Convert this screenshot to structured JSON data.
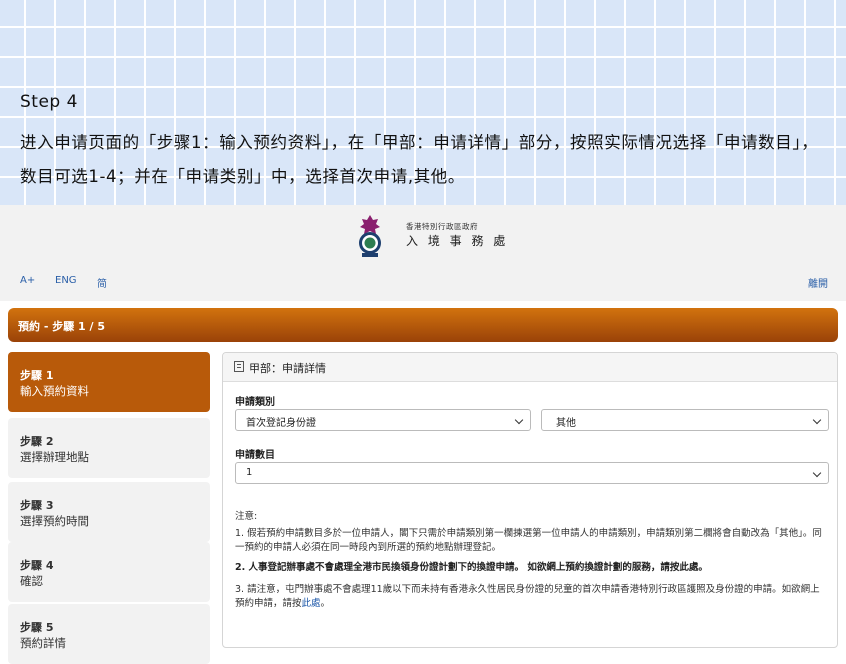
{
  "banner": {
    "step": "Step 4",
    "text": "进入申请页面的「步骤1：输入预约资料」，在「甲部：申请详情」部分，按照实际情况选择「申请数目」，数目可选1-4；并在「申请类别」中，选择首次申请,其他。"
  },
  "header": {
    "gov_name": "香港特別行政區政府",
    "dept_name": "入 境 事 務 處"
  },
  "toolbar": {
    "font_size": "A+",
    "lang_en": "ENG",
    "lang_sc": "简",
    "logout": "離開"
  },
  "progress": {
    "label": "預約 - 步驟 1 / 5",
    "current_step": 1,
    "total_steps": 5
  },
  "sidebar": {
    "items": [
      {
        "step": "步驟 1",
        "label": "輸入預約資料",
        "active": true
      },
      {
        "step": "步驟 2",
        "label": "選擇辦理地點",
        "active": false
      },
      {
        "step": "步驟 3",
        "label": "選擇預約時間",
        "active": false
      },
      {
        "step": "步驟 4",
        "label": "確認",
        "active": false
      },
      {
        "step": "步驟 5",
        "label": "預約詳情",
        "active": false
      }
    ]
  },
  "panel": {
    "title": "甲部：申請詳情",
    "category_label": "申請類別",
    "category_value_1": "首次登記身份證",
    "category_value_2": "其他",
    "count_label": "申請數目",
    "count_value": "1",
    "notes_title": "注意:",
    "note1": "1. 假若預約申請數目多於一位申請人，閣下只需於申請類別第一欄揀選第一位申請人的申請類別，申請類別第二欄將會自動改為「其他」。同一預約的申請人必須在同一時段內到所選的預約地點辦理登記。",
    "note2_text": "2. 人事登記辦事處不會處理全港市民換領身份證計劃下的換證申請。 如欲網上預約換證計劃的服務，請按",
    "note2_link": "此處",
    "note3_text": "3. 請注意，屯門辦事處不會處理11歲以下而未持有香港永久性居民身份證的兒童的首次申請香港特別行政區護照及身份證的申請。如欲網上預約申請，請按",
    "note3_link": "此處"
  },
  "colors": {
    "accent": "#b85a0a",
    "banner_bg": "#d9e6f8",
    "link": "#1a56a8"
  }
}
